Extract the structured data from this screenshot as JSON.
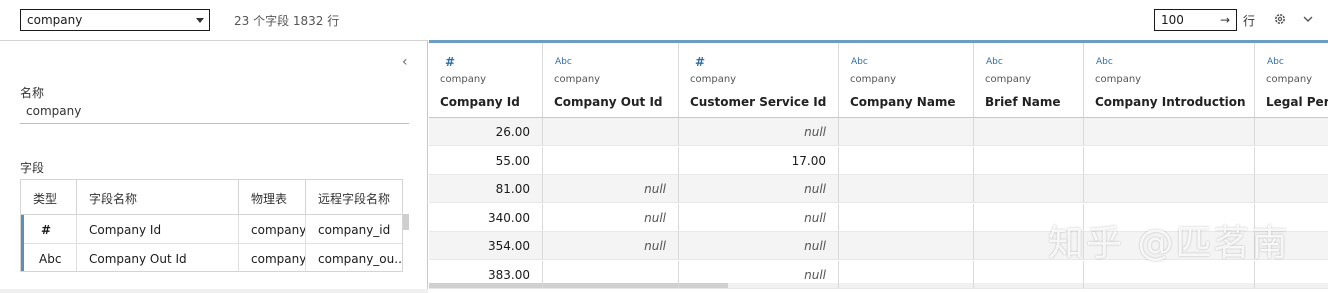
{
  "toolbar": {
    "table_select": "company",
    "summary": "23 个字段 1832 行",
    "rows_value": "100",
    "rows_label": "行",
    "icons": {
      "rows_arrow": "arrow-right-icon",
      "settings": "gear-icon",
      "menu": "chevron-down-icon"
    }
  },
  "left_panel": {
    "collapse_icon": "chevron-left-icon",
    "name_label": "名称",
    "name_value": "company",
    "fields_label": "字段",
    "columns": [
      "类型",
      "字段名称",
      "物理表",
      "远程字段名称"
    ],
    "rows": [
      {
        "type_icon": "#",
        "field_name": "Company Id",
        "physical_table": "company",
        "remote_name": "company_id"
      },
      {
        "type_icon": "Abc",
        "field_name": "Company Out Id",
        "physical_table": "company",
        "remote_name": "company_ou..."
      }
    ]
  },
  "grid": {
    "columns": [
      {
        "type": "#",
        "table": "company",
        "name": "Company Id"
      },
      {
        "type": "Abc",
        "table": "company",
        "name": "Company Out Id"
      },
      {
        "type": "#",
        "table": "company",
        "name": "Customer Service Id"
      },
      {
        "type": "Abc",
        "table": "company",
        "name": "Company Name"
      },
      {
        "type": "Abc",
        "table": "company",
        "name": "Brief Name"
      },
      {
        "type": "Abc",
        "table": "company",
        "name": "Company Introduction"
      },
      {
        "type": "Abc",
        "table": "company",
        "name": "Legal Perso"
      }
    ],
    "rows": [
      [
        "26.00",
        "",
        "null",
        "",
        "",
        "",
        ""
      ],
      [
        "55.00",
        "",
        "17.00",
        "",
        "",
        "",
        ""
      ],
      [
        "81.00",
        "null",
        "null",
        "",
        "",
        "",
        ""
      ],
      [
        "340.00",
        "null",
        "null",
        "",
        "",
        "",
        ""
      ],
      [
        "354.00",
        "null",
        "null",
        "",
        "",
        "",
        ""
      ],
      [
        "383.00",
        "",
        "null",
        "",
        "",
        "",
        ""
      ]
    ]
  },
  "watermark": "知乎 @匹茗南"
}
